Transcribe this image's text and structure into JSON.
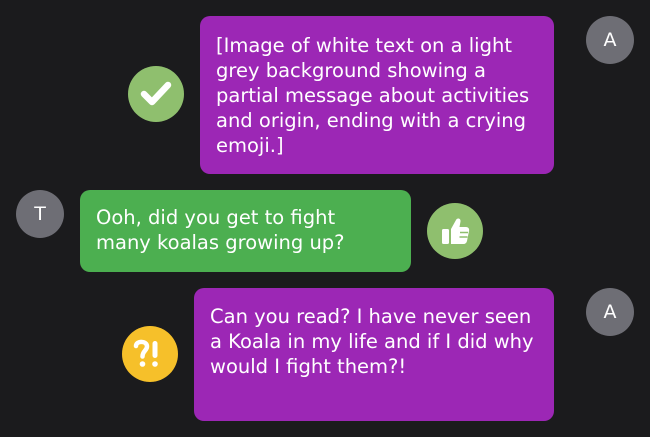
{
  "messages": [
    {
      "sender_initial": "A",
      "text": "[Image of white text on a light grey background showing a partial message about activities and origin, ending with a crying emoji.]",
      "reaction_icon": "check-mark-icon",
      "bubble_color": "#9c27b5"
    },
    {
      "sender_initial": "T",
      "text": "Ooh, did you get to fight many koalas growing up?",
      "reaction_icon": "thumbs-up-icon",
      "bubble_color": "#4caf50"
    },
    {
      "sender_initial": "A",
      "text": "Can you read? I have never seen a Koala in my life and if I did why would I fight them?!",
      "reaction_icon": "interrobang-icon",
      "bubble_color": "#9c27b5"
    }
  ],
  "colors": {
    "background": "#1b1b1d",
    "avatar": "#6e6e75",
    "reaction_green": "#8fbf6e",
    "reaction_yellow": "#f6c02a"
  }
}
